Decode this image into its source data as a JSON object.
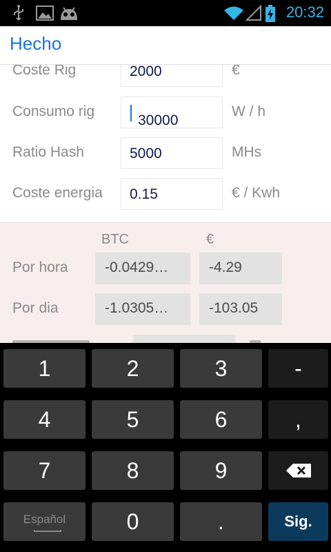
{
  "status_bar": {
    "time": "20:32",
    "icons": [
      "usb-icon",
      "image-icon",
      "android-head-icon",
      "wifi-icon",
      "signal-icon",
      "battery-charging-icon"
    ]
  },
  "action_bar": {
    "done_label": "Hecho"
  },
  "form": {
    "rows": [
      {
        "label": "Coste Rig",
        "value": "2000",
        "unit": "€"
      },
      {
        "label": "Consumo rig",
        "value": "30000",
        "unit": "W / h"
      },
      {
        "label": "Ratio Hash",
        "value": "5000",
        "unit": "MHs"
      },
      {
        "label": "Coste energia",
        "value": "0.15",
        "unit": "€ / Kwh"
      }
    ]
  },
  "results": {
    "headers": {
      "btc": "BTC",
      "eur": "€"
    },
    "rows": [
      {
        "label": "Por hora",
        "btc": "-0.0429…",
        "eur": "-4.29"
      },
      {
        "label": "Por dia",
        "btc": "-1.0305…",
        "eur": "-103.05"
      }
    ]
  },
  "keyboard": {
    "keys": [
      "1",
      "2",
      "3",
      "-",
      "4",
      "5",
      "6",
      ",",
      "7",
      "8",
      "9",
      "⌫",
      "Español",
      "0",
      ".",
      "Sig."
    ],
    "accent_color": "#0c3a5c"
  }
}
